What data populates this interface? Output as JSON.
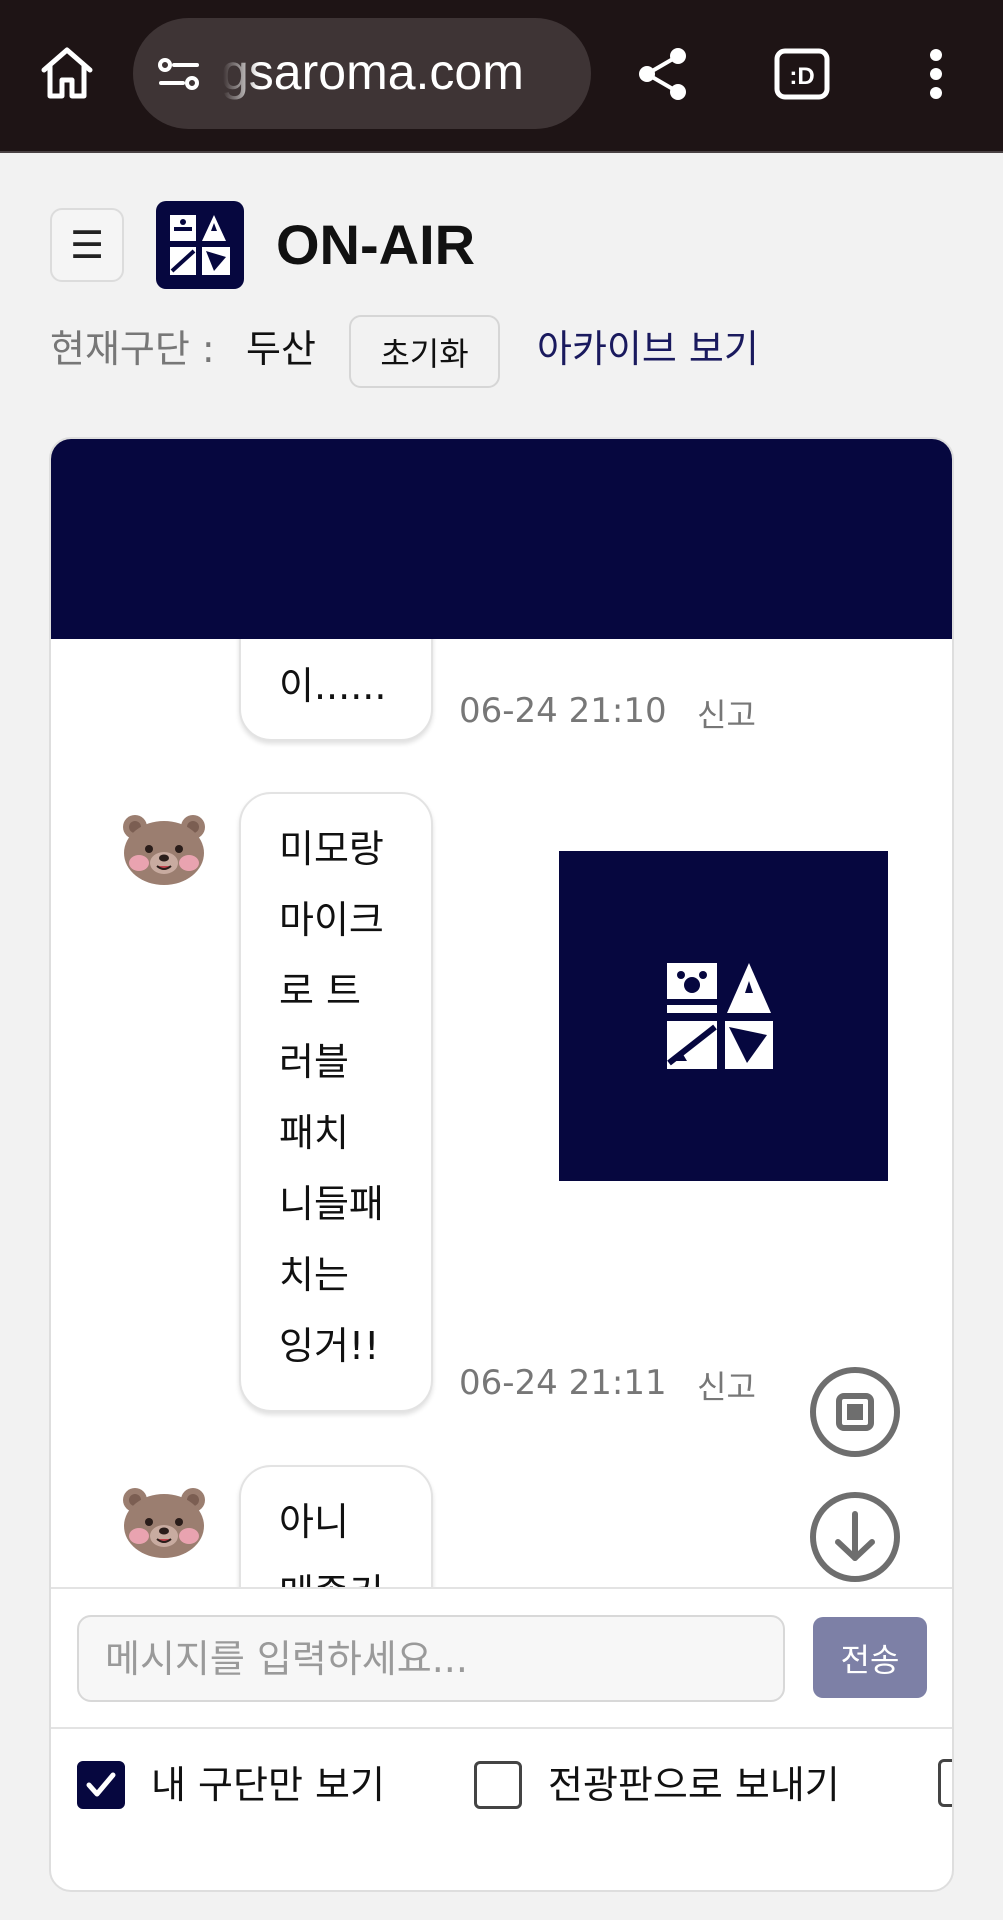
{
  "browser": {
    "url": "gsaroma.com",
    "tab_badge": ":D"
  },
  "header": {
    "menu_glyph": "☰",
    "title": "ON-AIR"
  },
  "section": {
    "label": "현재구단 :",
    "value": "두산",
    "reset_label": "초기화",
    "archive_label": "아카이브 보기"
  },
  "messages": [
    {
      "lines": [
        "이......"
      ],
      "time": "06-24 21:10",
      "report": "신고"
    },
    {
      "lines": [
        "미모랑",
        "마이크",
        "로 트",
        "러블",
        "패치",
        "니들패",
        "치는",
        "잉거!!"
      ],
      "time": "06-24 21:11",
      "report": "신고"
    },
    {
      "lines": [
        "아니",
        "메종키"
      ]
    }
  ],
  "composer": {
    "placeholder": "메시지를 입력하세요...",
    "send_label": "전송"
  },
  "options": [
    {
      "label": "내 구단만 보기",
      "checked": true
    },
    {
      "label": "전광판으로 보내기",
      "checked": false
    }
  ],
  "colors": {
    "navy": "#06073f",
    "send_button": "#7d80a6",
    "browser_bar": "#1e1415"
  }
}
